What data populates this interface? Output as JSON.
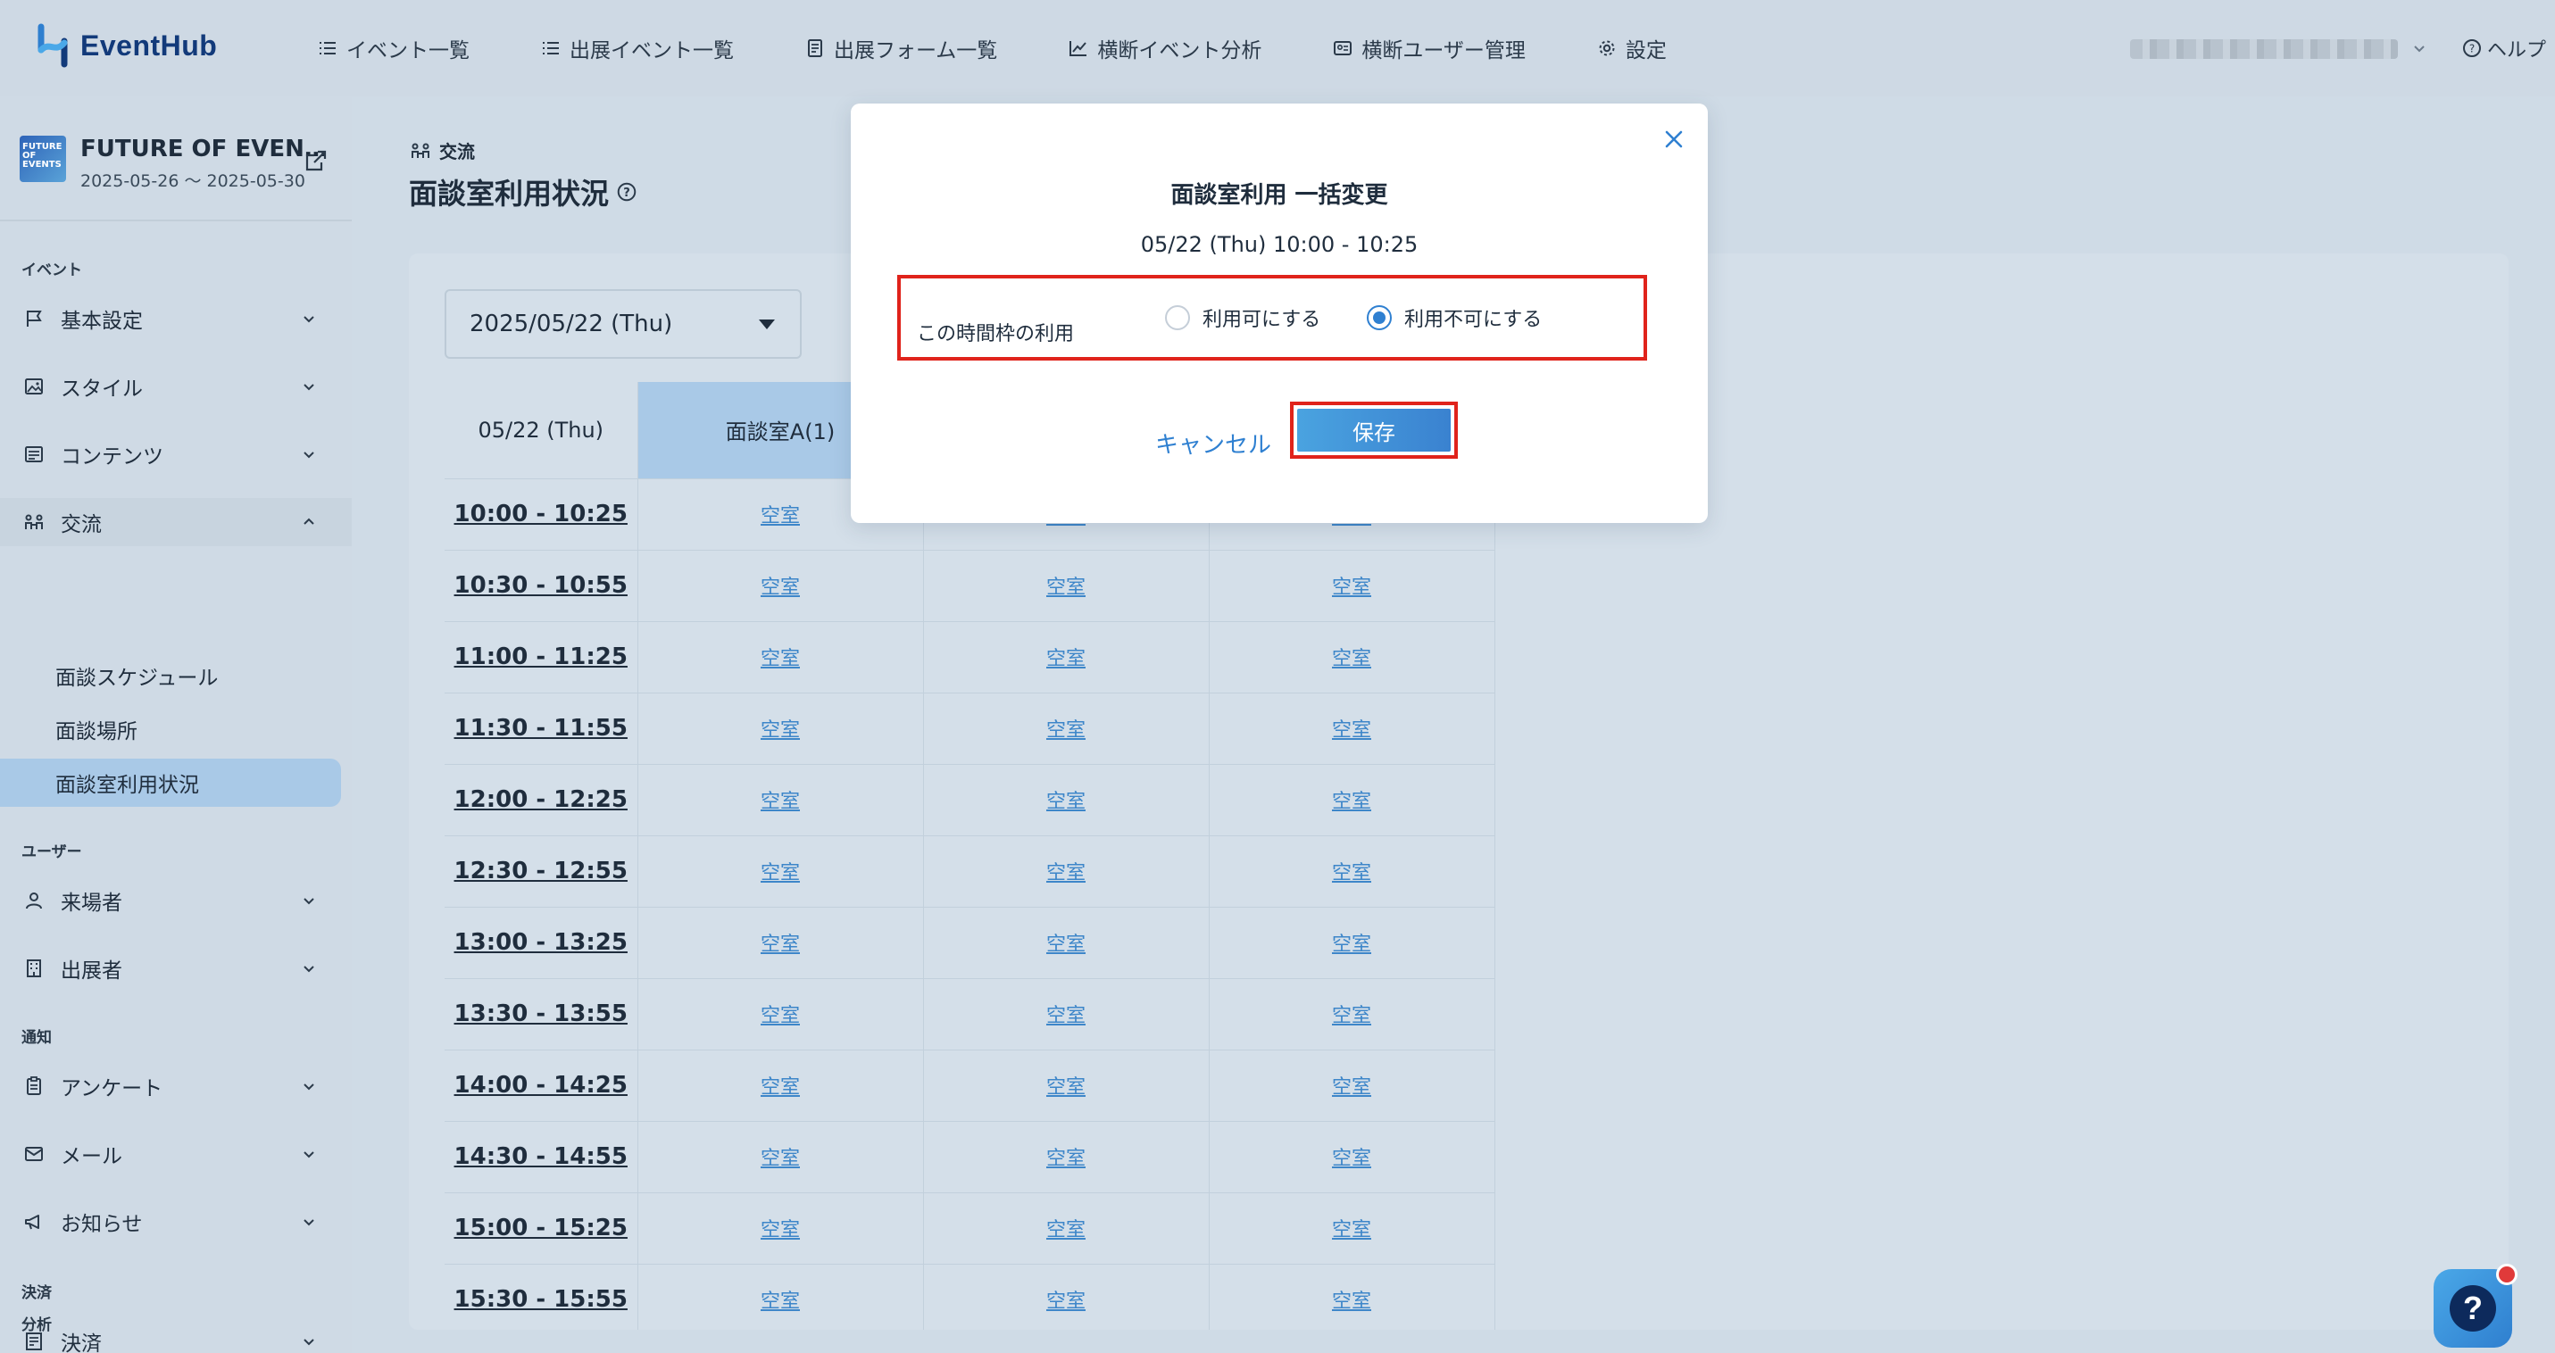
{
  "header": {
    "logo_text": "EventHub",
    "nav": [
      {
        "label": "イベント一覧",
        "icon": "list-icon"
      },
      {
        "label": "出展イベント一覧",
        "icon": "list-icon"
      },
      {
        "label": "出展フォーム一覧",
        "icon": "form-icon"
      },
      {
        "label": "横断イベント分析",
        "icon": "chart-icon"
      },
      {
        "label": "横断ユーザー管理",
        "icon": "id-card-icon"
      },
      {
        "label": "設定",
        "icon": "gear-icon"
      }
    ],
    "help_label": "ヘルプ"
  },
  "sidebar": {
    "event": {
      "thumb_text": "FUTURE OF EVENTS",
      "title": "FUTURE OF EVEN…",
      "dates": "2025-05-26 〜 2025-05-30"
    },
    "sections": {
      "event": "イベント",
      "user": "ユーザー",
      "notice": "通知",
      "payment": "決済",
      "analysis": "分析"
    },
    "items": {
      "basic": "基本設定",
      "style": "スタイル",
      "contents": "コンテンツ",
      "exchange": "交流",
      "schedule": "面談スケジュール",
      "place": "面談場所",
      "room_usage": "面談室利用状況",
      "visitors": "来場者",
      "exhibitors": "出展者",
      "survey": "アンケート",
      "mail": "メール",
      "news": "お知らせ",
      "payment": "決済"
    }
  },
  "main": {
    "breadcrumb": "交流",
    "title": "面談室利用状況",
    "date_select": "2025/05/22 (Thu)",
    "table": {
      "date_header": "05/22 (Thu)",
      "rooms": [
        "面談室A(1)",
        "",
        ""
      ],
      "slots": [
        "10:00 - 10:25",
        "10:30 - 10:55",
        "11:00 - 11:25",
        "11:30 - 11:55",
        "12:00 - 12:25",
        "12:30 - 12:55",
        "13:00 - 13:25",
        "13:30 - 13:55",
        "14:00 - 14:25",
        "14:30 - 14:55",
        "15:00 - 15:25",
        "15:30 - 15:55"
      ],
      "cell_label": "空室"
    }
  },
  "modal": {
    "title": "面談室利用 一括変更",
    "subtitle": "05/22 (Thu) 10:00 - 10:25",
    "option_label": "この時間枠の利用",
    "radio_available": "利用可にする",
    "radio_unavailable": "利用不可にする",
    "selected": "unavailable",
    "cancel_label": "キャンセル",
    "save_label": "保存"
  },
  "fab": {
    "label": "?"
  },
  "colors": {
    "accent": "#2f80d1",
    "highlight": "#e0231b",
    "active_bg": "#a9c9e7"
  }
}
